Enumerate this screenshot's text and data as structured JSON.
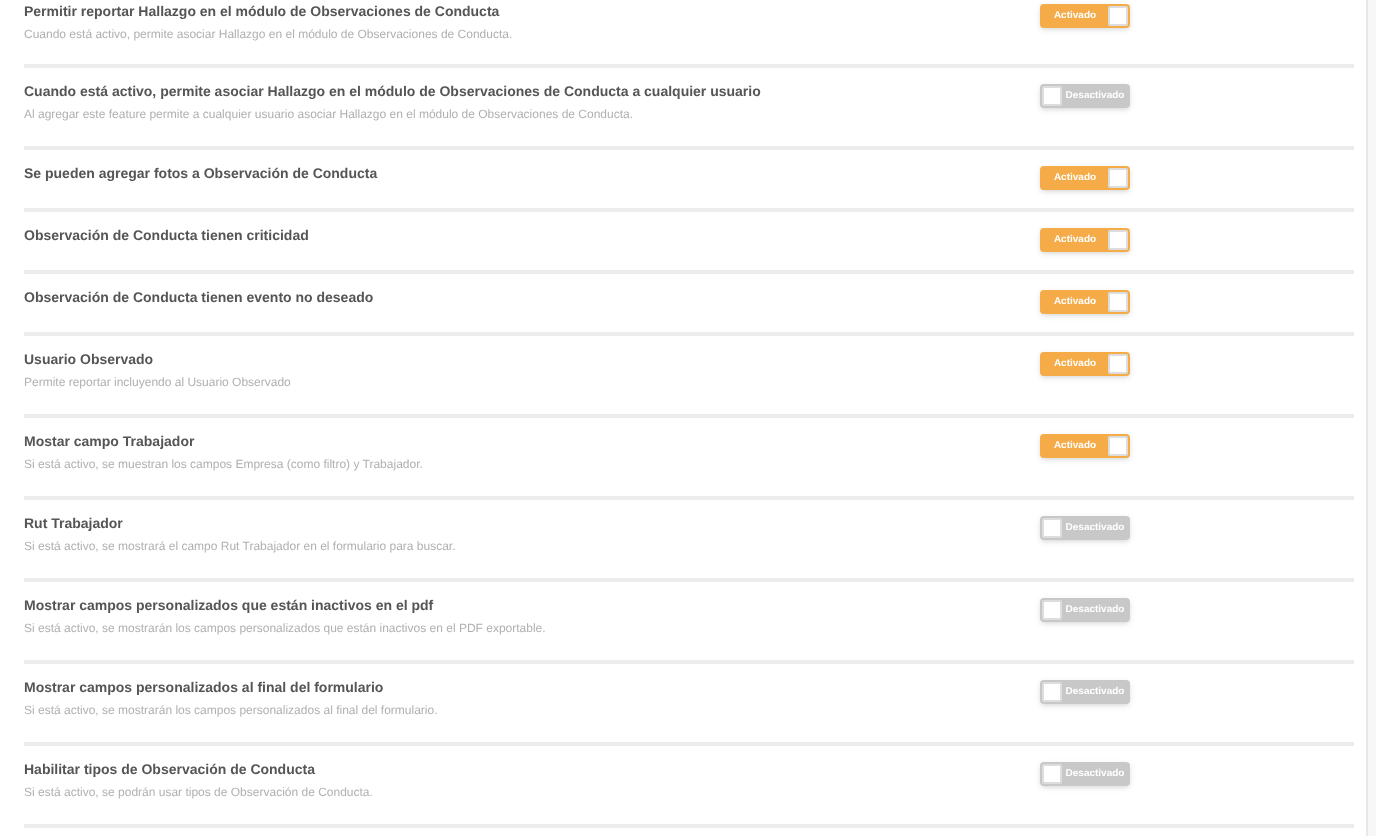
{
  "settings": [
    {
      "title": "Permitir reportar Hallazgo en el módulo de Observaciones de Conducta",
      "description": "Cuando está activo, permite asociar Hallazgo en el módulo de Observaciones de Conducta.",
      "on": true,
      "label": "Activado"
    },
    {
      "title": "Cuando está activo, permite asociar Hallazgo en el módulo de Observaciones de Conducta a cualquier usuario",
      "description": "Al agregar este feature permite a cualquier usuario asociar Hallazgo en el módulo de Observaciones de Conducta.",
      "on": false,
      "label": "Desactivado"
    },
    {
      "title": "Se pueden agregar fotos a Observación de Conducta",
      "on": true,
      "label": "Activado"
    },
    {
      "title": "Observación de Conducta tienen criticidad",
      "on": true,
      "label": "Activado"
    },
    {
      "title": "Observación de Conducta tienen evento no deseado",
      "on": true,
      "label": "Activado"
    },
    {
      "title": "Usuario Observado",
      "description": "Permite reportar incluyendo al Usuario Observado",
      "on": true,
      "label": "Activado"
    },
    {
      "title": "Mostar campo Trabajador",
      "description": "Si está activo, se muestran los campos Empresa (como filtro) y Trabajador.",
      "on": true,
      "label": "Activado"
    },
    {
      "title": "Rut Trabajador",
      "description": "Si está activo, se mostrará el campo Rut Trabajador en el formulario para buscar.",
      "on": false,
      "label": "Desactivado"
    },
    {
      "title": "Mostrar campos personalizados que están inactivos en el pdf",
      "description": "Si está activo, se mostrarán los campos personalizados que están inactivos en el PDF exportable.",
      "on": false,
      "label": "Desactivado"
    },
    {
      "title": "Mostrar campos personalizados al final del formulario",
      "description": "Si está activo, se mostrarán los campos personalizados al final del formulario.",
      "on": false,
      "label": "Desactivado"
    },
    {
      "title": "Habilitar tipos de Observación de Conducta",
      "description": "Si está activo, se podrán usar tipos de Observación de Conducta.",
      "on": false,
      "label": "Desactivado"
    }
  ]
}
